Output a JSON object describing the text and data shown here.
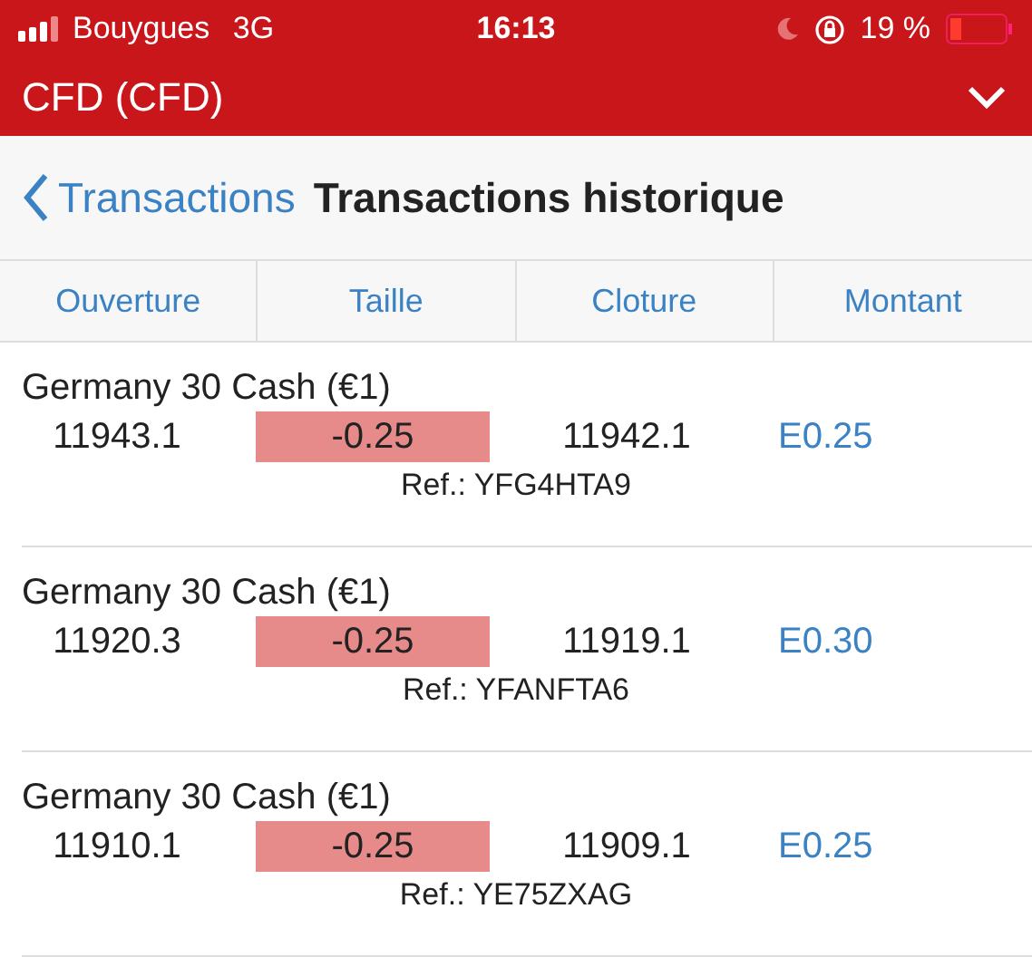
{
  "status_bar": {
    "carrier": "Bouygues",
    "network": "3G",
    "time": "16:13",
    "battery": "19 %"
  },
  "header": {
    "title": "CFD (CFD)"
  },
  "nav": {
    "back": "Transactions",
    "title": "Transactions historique"
  },
  "columns": [
    "Ouverture",
    "Taille",
    "Cloture",
    "Montant"
  ],
  "rows": [
    {
      "name": "Germany 30 Cash (€1)",
      "open": "11943.1",
      "size": "-0.25",
      "close": "11942.1",
      "amount": "E0.25",
      "ref": "Ref.: YFG4HTA9"
    },
    {
      "name": "Germany 30 Cash (€1)",
      "open": "11920.3",
      "size": "-0.25",
      "close": "11919.1",
      "amount": "E0.30",
      "ref": "Ref.: YFANFTA6"
    },
    {
      "name": "Germany 30 Cash (€1)",
      "open": "11910.1",
      "size": "-0.25",
      "close": "11909.1",
      "amount": "E0.25",
      "ref": "Ref.: YE75ZXAG"
    }
  ]
}
